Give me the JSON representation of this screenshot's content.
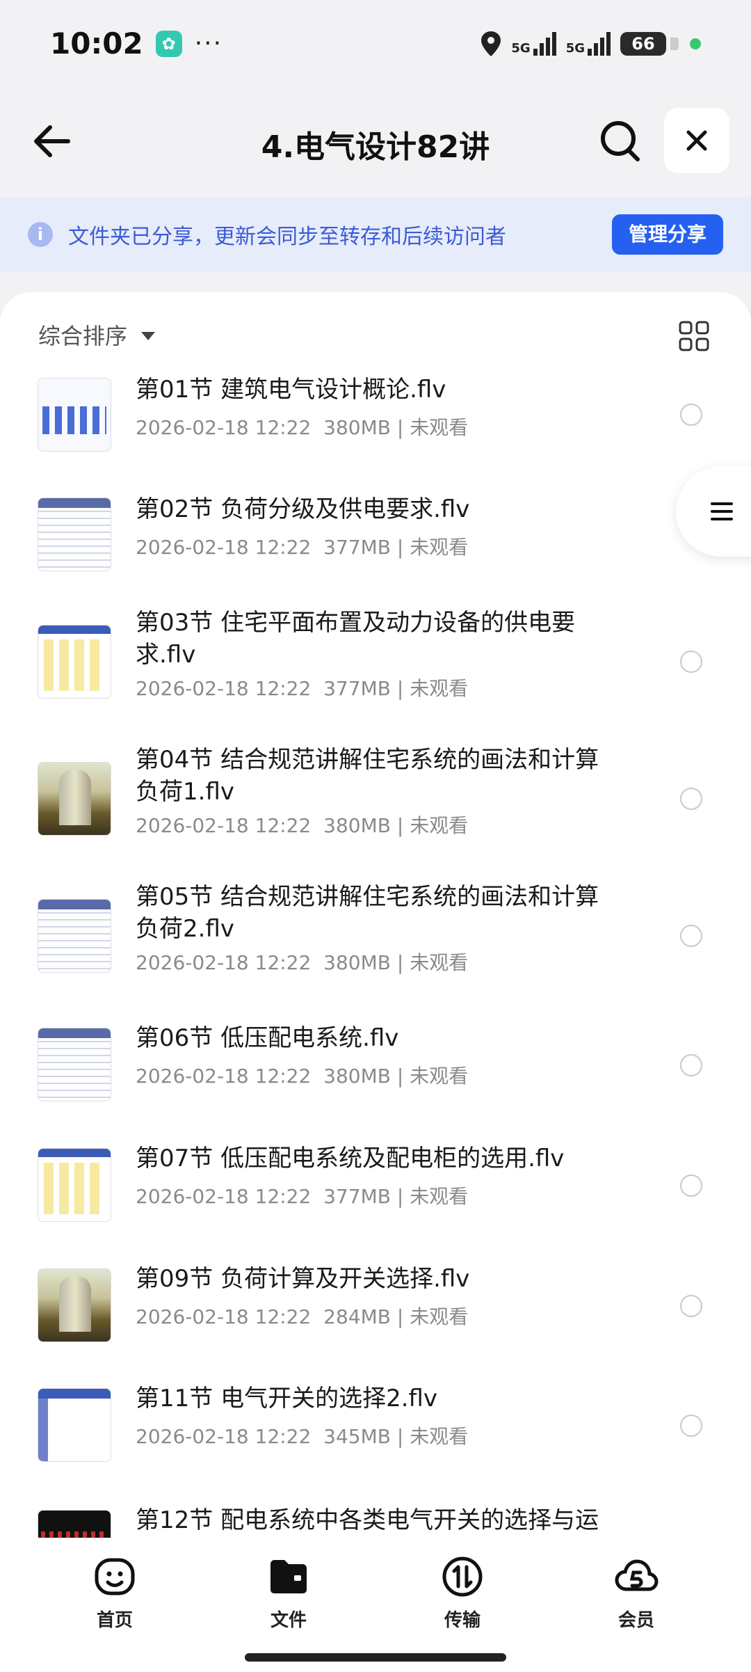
{
  "status_bar": {
    "time": "10:02",
    "more": "···",
    "battery": "66",
    "net1": "5G",
    "net2": "5G"
  },
  "header": {
    "title": "4.电气设计82讲"
  },
  "banner": {
    "text": "文件夹已分享，更新会同步至转存和后续访问者",
    "button": "管理分享"
  },
  "sort": {
    "label": "综合排序"
  },
  "files": [
    {
      "name": "第01节  建筑电气设计概论.flv",
      "date": "2026-02-18 12:22",
      "size": "380MB",
      "status": "未观看",
      "thumb": "diagram"
    },
    {
      "name": "第02节  负荷分级及供电要求.flv",
      "date": "2026-02-18 12:22",
      "size": "377MB",
      "status": "未观看",
      "thumb": "doc"
    },
    {
      "name": "第03节  住宅平面布置及动力设备的供电要求.flv",
      "date": "2026-02-18 12:22",
      "size": "377MB",
      "status": "未观看",
      "thumb": "sheet"
    },
    {
      "name": "第04节  结合规范讲解住宅系统的画法和计算负荷1.flv",
      "date": "2026-02-18 12:22",
      "size": "380MB",
      "status": "未观看",
      "thumb": "photo"
    },
    {
      "name": "第05节  结合规范讲解住宅系统的画法和计算负荷2.flv",
      "date": "2026-02-18 12:22",
      "size": "380MB",
      "status": "未观看",
      "thumb": "doc"
    },
    {
      "name": "第06节  低压配电系统.flv",
      "date": "2026-02-18 12:22",
      "size": "380MB",
      "status": "未观看",
      "thumb": "doc"
    },
    {
      "name": "第07节  低压配电系统及配电柜的选用.flv",
      "date": "2026-02-18 12:22",
      "size": "377MB",
      "status": "未观看",
      "thumb": "sheet"
    },
    {
      "name": "第09节  负荷计算及开关选择.flv",
      "date": "2026-02-18 12:22",
      "size": "284MB",
      "status": "未观看",
      "thumb": "photo"
    },
    {
      "name": "第11节  电气开关的选择2.flv",
      "date": "2026-02-18 12:22",
      "size": "345MB",
      "status": "未观看",
      "thumb": "blank"
    },
    {
      "name": "第12节  配电系统中各类电气开关的选择与运",
      "date": "",
      "size": "",
      "status": "",
      "thumb": "dark"
    }
  ],
  "nav": [
    {
      "label": "首页",
      "icon": "smile-icon"
    },
    {
      "label": "文件",
      "icon": "folder-icon"
    },
    {
      "label": "传输",
      "icon": "transfer-icon"
    },
    {
      "label": "会员",
      "icon": "cloud-vip-icon"
    }
  ],
  "colors": {
    "accent": "#2560f0",
    "banner_bg": "#e7ecfb",
    "banner_text": "#3b5bd6"
  }
}
